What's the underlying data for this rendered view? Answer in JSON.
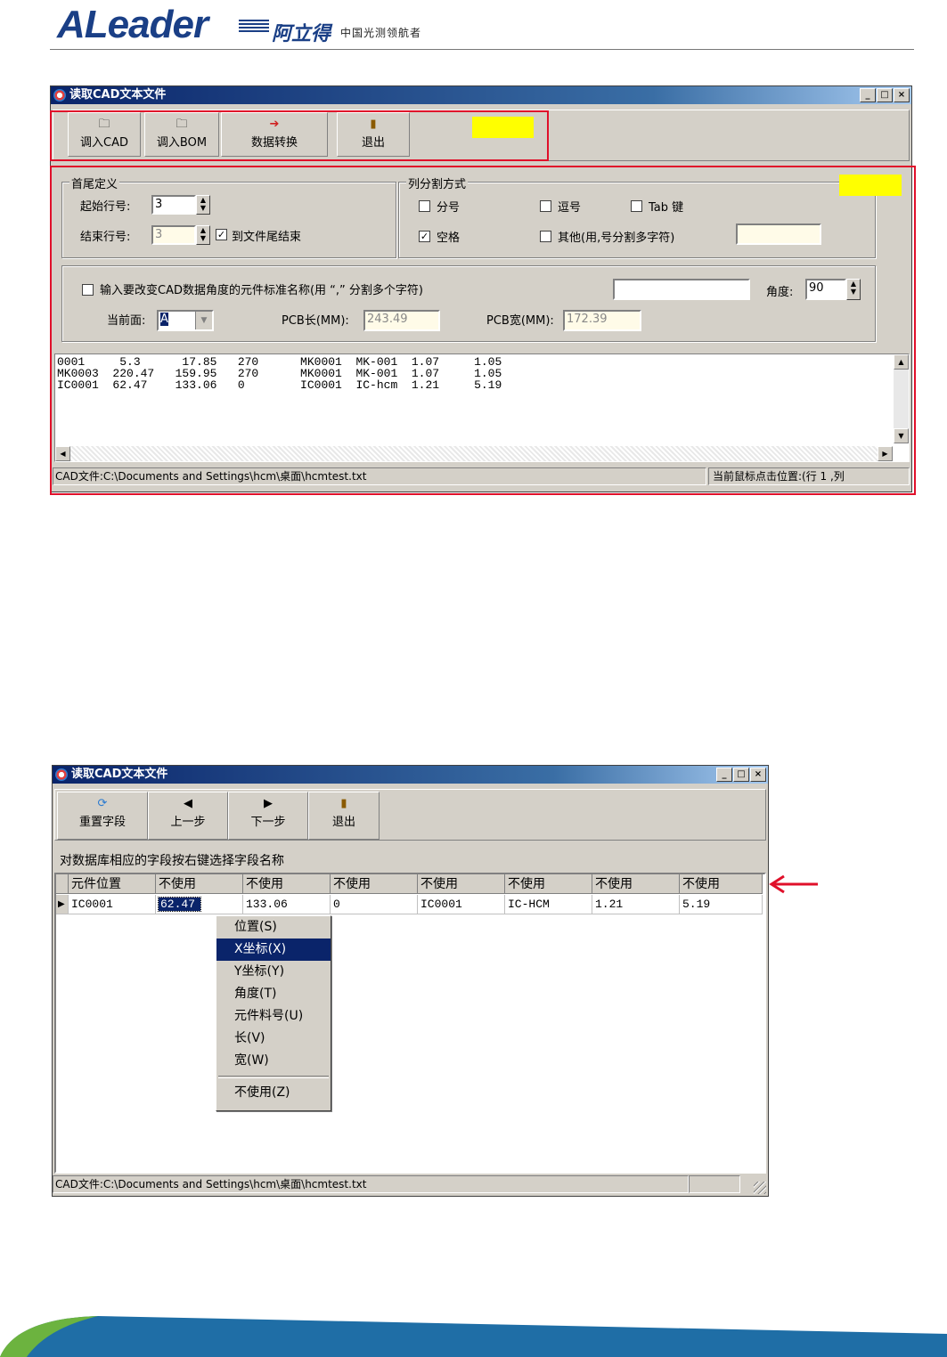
{
  "header": {
    "logo": "ALeader",
    "logo_cn": "阿立得",
    "tagline": "中国光测领航者"
  },
  "window1": {
    "title": "读取CAD文本文件",
    "caption_buttons": [
      "_",
      "□",
      "×"
    ],
    "toolbar": [
      {
        "label": "调入CAD",
        "icon": "folder-icon"
      },
      {
        "label": "调入BOM",
        "icon": "folder-icon"
      },
      {
        "label": "数据转换",
        "icon": "convert-icon"
      },
      {
        "label": "退出",
        "icon": "exit-door-icon"
      }
    ],
    "head_tail": {
      "legend": "首尾定义",
      "start_label": "起始行号:",
      "start_value": "3",
      "end_label": "结束行号:",
      "end_value": "3",
      "to_end_label": "到文件尾结束",
      "to_end_checked": true
    },
    "column_split": {
      "legend": "列分割方式",
      "semicolon": "分号",
      "comma": "逗号",
      "tab": "Tab 键",
      "space": "空格",
      "space_checked": true,
      "other": "其他(用,号分割多字符)",
      "other_value": ""
    },
    "angle_section": {
      "checkbox_label": "输入要改变CAD数据角度的元件标准名称(用 “,” 分割多个字符)",
      "name_value": "",
      "angle_label": "角度:",
      "angle_value": "90",
      "side_label": "当前面:",
      "side_value": "A",
      "pcb_len_label": "PCB长(MM):",
      "pcb_len_value": "243.49",
      "pcb_wid_label": "PCB宽(MM):",
      "pcb_wid_value": "172.39"
    },
    "text_lines": [
      "0001     5.3      17.85   270      MK0001  MK-001  1.07     1.05",
      "MK0003  220.47   159.95   270      MK0001  MK-001  1.07     1.05",
      "IC0001  62.47    133.06   0        IC0001  IC-hcm  1.21     5.19"
    ],
    "status_file": "CAD文件:C:\\Documents and Settings\\hcm\\桌面\\hcmtest.txt",
    "status_pos": "当前鼠标点击位置:(行 1 ,列"
  },
  "window2": {
    "title": "读取CAD文本文件",
    "caption_buttons": [
      "_",
      "□",
      "×"
    ],
    "toolbar": [
      {
        "label": "重置字段",
        "icon": "reset-icon"
      },
      {
        "label": "上一步",
        "icon": "left-arrow-icon"
      },
      {
        "label": "下一步",
        "icon": "right-arrow-icon"
      },
      {
        "label": "退出",
        "icon": "exit-door-icon"
      }
    ],
    "instruction": "对数据库相应的字段按右键选择字段名称",
    "columns": [
      "元件位置",
      "不使用",
      "不使用",
      "不使用",
      "不使用",
      "不使用",
      "不使用",
      "不使用"
    ],
    "row": [
      "IC0001",
      "62.47",
      "133.06",
      "0",
      "IC0001",
      "IC-HCM",
      "1.21",
      "5.19"
    ],
    "context_menu": [
      {
        "label": "位置(S)",
        "selected": false
      },
      {
        "label": "X坐标(X)",
        "selected": true
      },
      {
        "label": "Y坐标(Y)",
        "selected": false
      },
      {
        "label": "角度(T)",
        "selected": false
      },
      {
        "label": "元件料号(U)",
        "selected": false
      },
      {
        "label": "长(V)",
        "selected": false
      },
      {
        "label": "宽(W)",
        "selected": false
      },
      {
        "label": "不使用(Z)",
        "selected": false
      }
    ],
    "status_file": "CAD文件:C:\\Documents and Settings\\hcm\\桌面\\hcmtest.txt"
  },
  "colors": {
    "highlight_box": "#e0102a",
    "marker": "#ffff00",
    "arrow": "#e0102a",
    "menu_select": "#0a246a"
  }
}
